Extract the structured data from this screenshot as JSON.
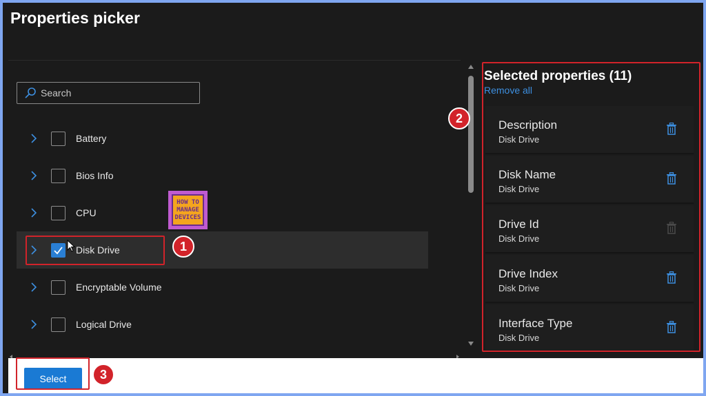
{
  "header": {
    "title": "Properties picker"
  },
  "search": {
    "placeholder": "Search"
  },
  "categories": [
    {
      "label": "Battery",
      "checked": false
    },
    {
      "label": "Bios Info",
      "checked": false
    },
    {
      "label": "CPU",
      "checked": false
    },
    {
      "label": "Disk Drive",
      "checked": true
    },
    {
      "label": "Encryptable Volume",
      "checked": false
    },
    {
      "label": "Logical Drive",
      "checked": false
    }
  ],
  "selected": {
    "title": "Selected properties (11)",
    "remove_all": "Remove all",
    "items": [
      {
        "name": "Description",
        "category": "Disk Drive",
        "removable": true
      },
      {
        "name": "Disk Name",
        "category": "Disk Drive",
        "removable": true
      },
      {
        "name": "Drive Id",
        "category": "Disk Drive",
        "removable": false
      },
      {
        "name": "Drive Index",
        "category": "Disk Drive",
        "removable": true
      },
      {
        "name": "Interface Type",
        "category": "Disk Drive",
        "removable": true
      }
    ]
  },
  "footer": {
    "select_label": "Select"
  },
  "annotations": {
    "step1": "1",
    "step2": "2",
    "step3": "3"
  },
  "logo": {
    "line1": "HOW TO",
    "line2": "MANAGE",
    "line3": "DEVICES"
  },
  "colors": {
    "accent": "#2a7fd4",
    "annotation_red": "#d2232a",
    "background": "#1b1b1b"
  }
}
